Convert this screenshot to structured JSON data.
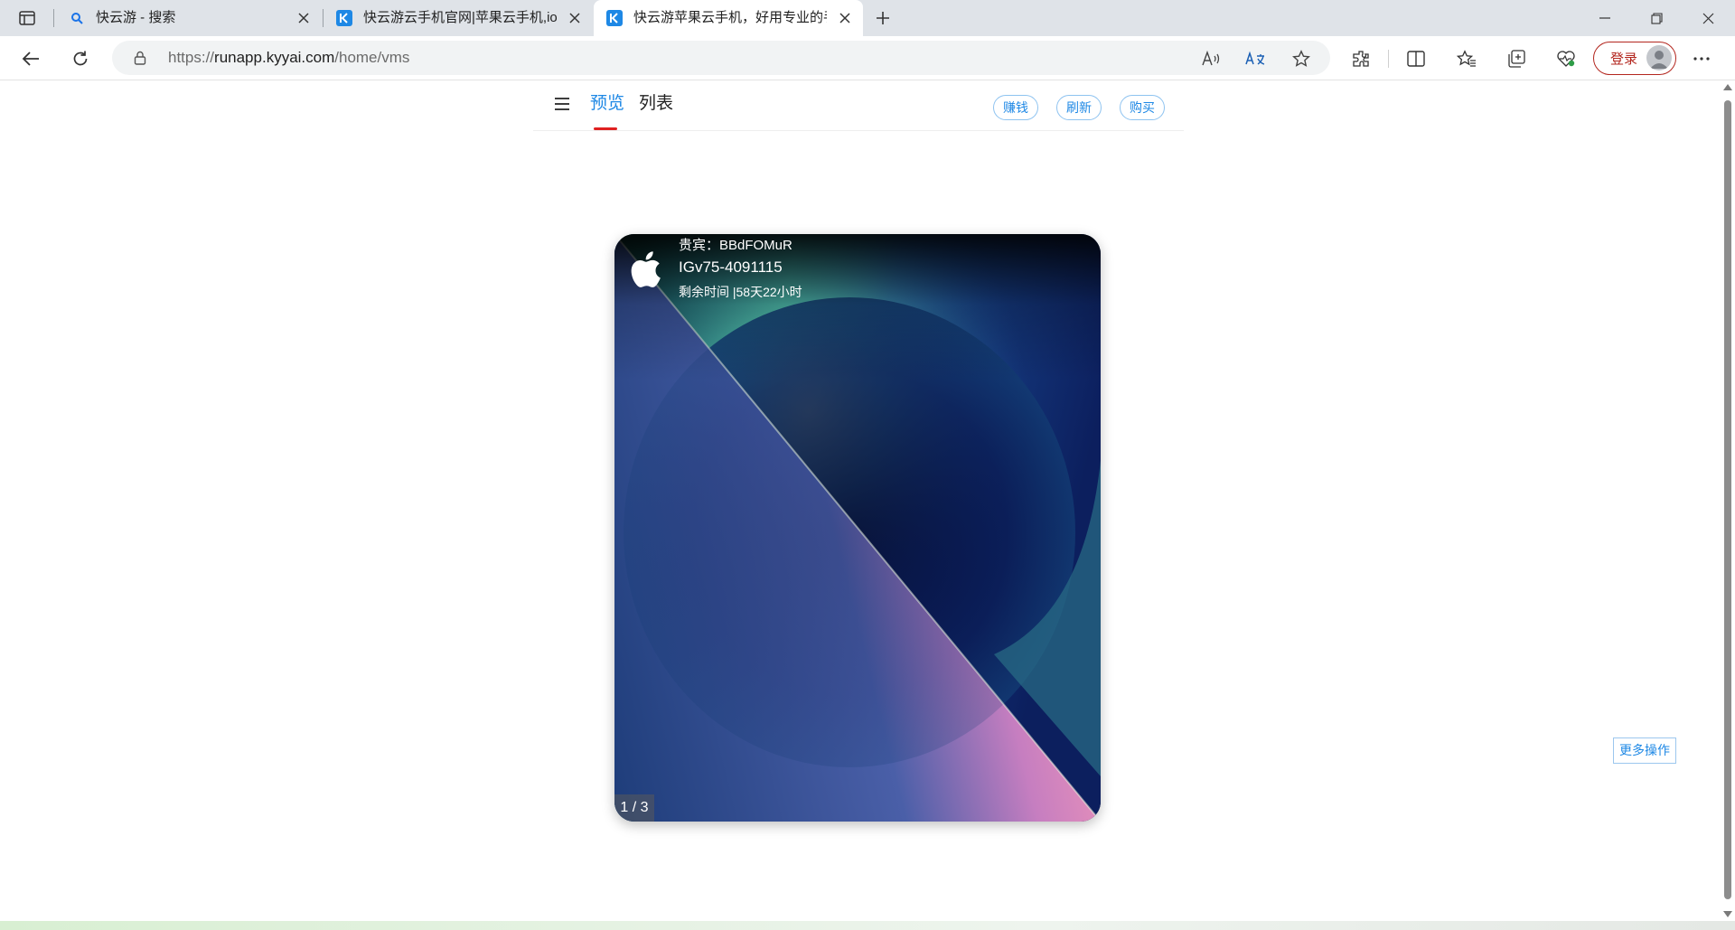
{
  "browser": {
    "tabs": [
      {
        "title": "快云游 - 搜索",
        "favicon": "search-icon",
        "active": false
      },
      {
        "title": "快云游云手机官网|苹果云手机,ios",
        "favicon": "kyy-logo-icon",
        "active": false
      },
      {
        "title": "快云游苹果云手机，好用专业的手",
        "favicon": "kyy-logo-icon",
        "active": true
      }
    ],
    "url": {
      "prefix": "https://",
      "host": "runapp.kyyai.com",
      "path": "/home/vms"
    },
    "login_label": "登录",
    "accent": "#b3261e"
  },
  "page": {
    "nav": {
      "tabs": [
        {
          "label": "预览",
          "active": true
        },
        {
          "label": "列表",
          "active": false
        }
      ]
    },
    "actions": {
      "earn": "赚钱",
      "refresh": "刷新",
      "buy": "购买"
    },
    "device": {
      "guest": "贵宾：BBdFOMuR",
      "id": "IGv75-4091115",
      "remaining": "剩余时间 |58天22小时",
      "pager": "1 / 3"
    },
    "more_ops": "更多操作",
    "accent": "#1e88e5"
  }
}
